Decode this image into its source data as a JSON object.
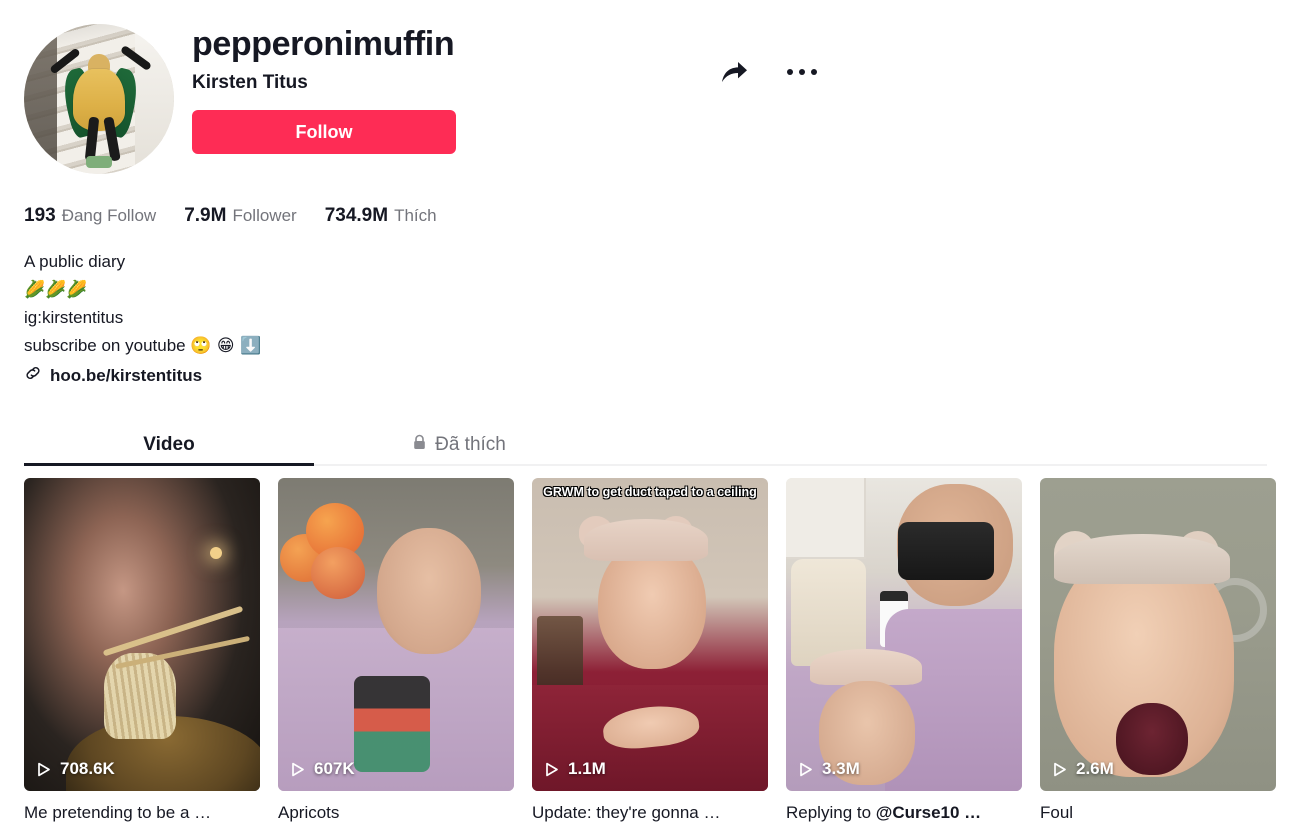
{
  "profile": {
    "username": "pepperonimuffin",
    "display_name": "Kirsten Titus",
    "follow_button": "Follow",
    "avatar_alt": "person-in-corn-costume-on-stairs"
  },
  "actions": {
    "share_icon": "share-arrow-icon",
    "more_icon": "more-options-icon"
  },
  "stats": [
    {
      "value": "193",
      "label": "Đang Follow"
    },
    {
      "value": "7.9M",
      "label": "Follower"
    },
    {
      "value": "734.9M",
      "label": "Thích"
    }
  ],
  "bio": {
    "line1": "A public diary",
    "line2": "🌽🌽🌽",
    "line3": "ig:kirstentitus",
    "line4_text": "subscribe on youtube ",
    "line4_emoji": "🙄 😁 ⬇️",
    "link_icon": "link-chain-icon",
    "link_text": "hoo.be/kirstentitus"
  },
  "tabs": [
    {
      "label": "Video",
      "active": true,
      "icon": null
    },
    {
      "label": "Đã thích",
      "active": false,
      "icon": "lock-icon"
    }
  ],
  "videos": [
    {
      "views": "708.6K",
      "caption": "Me pretending to be a …",
      "overlay": ""
    },
    {
      "views": "607K",
      "caption": "Apricots",
      "overlay": ""
    },
    {
      "views": "1.1M",
      "caption": "Update: they're gonna …",
      "overlay": "GRWM to get duct taped to a ceiling"
    },
    {
      "views": "3.3M",
      "caption_prefix": "Replying to ",
      "caption_mention": "@Curse10 …",
      "caption": "Replying to @Curse10 …",
      "views_label": "3.3M",
      "overlay": ""
    },
    {
      "views": "2.6M",
      "caption": "Foul",
      "overlay": ""
    }
  ],
  "colors": {
    "accent": "#FE2C55",
    "text_primary": "#161823",
    "text_secondary": "#73747b"
  }
}
